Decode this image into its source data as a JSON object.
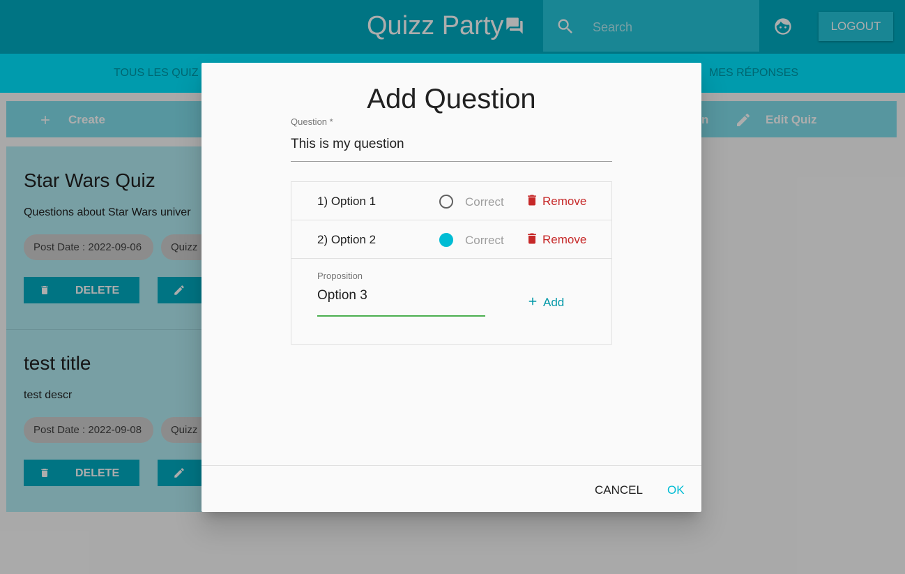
{
  "header": {
    "app_title": "Quizz Party",
    "search_placeholder": "Search",
    "logout_label": "LOGOUT"
  },
  "nav": {
    "items": [
      "TOUS LES QUIZ",
      "MES RÉPONSES"
    ]
  },
  "toolbar": {
    "create_label": "Create",
    "edit_quiz_label": "Edit Quiz",
    "partial_label": "n"
  },
  "quizzes": [
    {
      "title": "Star Wars Quiz",
      "description": "Questions about Star Wars univer",
      "post_date": "Post Date : 2022-09-06",
      "chip2": "Quizz",
      "delete_label": "DELETE"
    },
    {
      "title": "test title",
      "description": "test descr",
      "post_date": "Post Date : 2022-09-08",
      "chip2": "Quizz",
      "delete_label": "DELETE"
    }
  ],
  "dialog": {
    "title": "Add Question",
    "question_label": "Question *",
    "question_value": "This is my question",
    "options": [
      {
        "text": "1) Option 1",
        "correct_label": "Correct",
        "checked": false,
        "remove_label": "Remove"
      },
      {
        "text": "2) Option 2",
        "correct_label": "Correct",
        "checked": true,
        "remove_label": "Remove"
      }
    ],
    "proposition_label": "Proposition",
    "proposition_value": "Option 3",
    "add_label": "Add",
    "cancel_label": "CANCEL",
    "ok_label": "OK"
  },
  "colors": {
    "primary": "#00acc1",
    "accent": "#00bcd4",
    "danger": "#c62828",
    "focus_green": "#4caf50"
  }
}
